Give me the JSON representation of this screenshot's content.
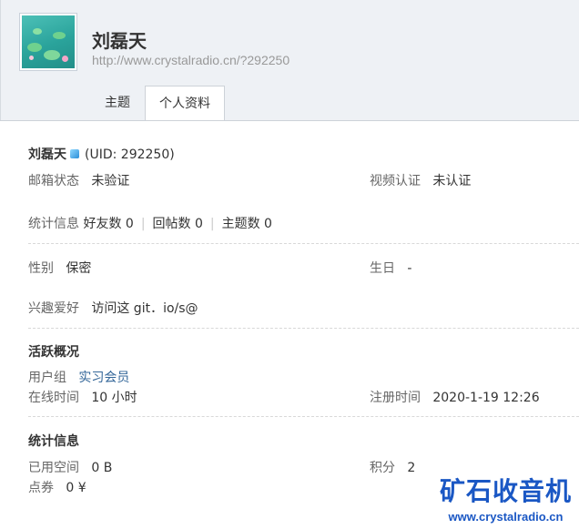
{
  "header": {
    "username": "刘磊天",
    "url": "http://www.crystalradio.cn/?292250"
  },
  "tabs": [
    "主题",
    "个人资料"
  ],
  "profile": {
    "name": "刘磊天",
    "uid": "(UID: 292250)",
    "email_label": "邮箱状态",
    "email_value": "未验证",
    "video_label": "视频认证",
    "video_value": "未认证",
    "stats_label": "统计信息",
    "friends": "好友数 0",
    "replies": "回帖数 0",
    "threads": "主题数 0",
    "gender_label": "性别",
    "gender_value": "保密",
    "birthday_label": "生日",
    "birthday_value": "-",
    "hobby_label": "兴趣爱好",
    "hobby_value": "访问这 git．io/s@"
  },
  "activity": {
    "title": "活跃概况",
    "group_label": "用户组",
    "group_value": "实习会员",
    "online_label": "在线时间",
    "online_value": "10 小时",
    "reg_label": "注册时间",
    "reg_value": "2020-1-19 12:26"
  },
  "stats": {
    "title": "统计信息",
    "space_label": "已用空间",
    "space_value": "0 B",
    "points_label": "积分",
    "points_value": "2",
    "coupon_label": "点券",
    "coupon_value": "0 ¥"
  },
  "watermark": {
    "title": "矿石收音机",
    "url": "www.crystalradio.cn"
  }
}
